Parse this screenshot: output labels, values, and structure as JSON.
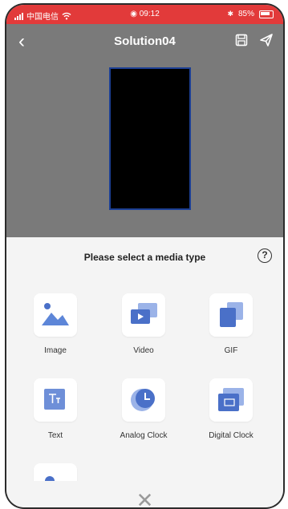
{
  "status": {
    "carrier": "中国电信",
    "time": "09:12",
    "battery": "85%"
  },
  "header": {
    "title": "Solution04"
  },
  "sheet": {
    "title": "Please select a media type",
    "help_glyph": "?",
    "items": [
      {
        "label": "Image"
      },
      {
        "label": "Video"
      },
      {
        "label": "GIF"
      },
      {
        "label": "Text"
      },
      {
        "label": "Analog Clock"
      },
      {
        "label": "Digital Clock"
      }
    ],
    "close_glyph": "✕"
  },
  "colors": {
    "status_bar": "#e23a3a",
    "header_bg": "#7a7a7a",
    "icon_blue": "#4a70c8",
    "screen_border": "#1c3f94"
  }
}
